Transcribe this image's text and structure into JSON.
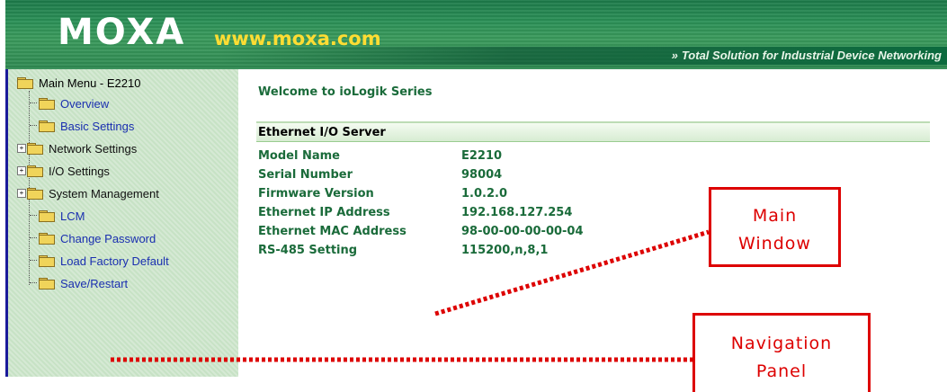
{
  "header": {
    "logo_text": "MOXA",
    "url": "www.moxa.com",
    "tagline_chevron": "»",
    "tagline": "Total Solution for Industrial Device Networking",
    "brand_color": "#2a8f56",
    "url_color": "#ffdd33"
  },
  "nav": {
    "root_label": "Main Menu - E2210",
    "items": [
      {
        "label": "Overview",
        "expandable": false
      },
      {
        "label": "Basic Settings",
        "expandable": false
      },
      {
        "label": "Network Settings",
        "expandable": true
      },
      {
        "label": "I/O Settings",
        "expandable": true
      },
      {
        "label": "System Management",
        "expandable": true
      },
      {
        "label": "LCM",
        "expandable": false
      },
      {
        "label": "Change Password",
        "expandable": false
      },
      {
        "label": "Load Factory Default",
        "expandable": false
      },
      {
        "label": "Save/Restart",
        "expandable": false
      }
    ],
    "expander_symbol": "+"
  },
  "main": {
    "welcome": "Welcome to ioLogik Series",
    "section_title": "Ethernet I/O Server",
    "rows": [
      {
        "label": "Model Name",
        "value": "E2210"
      },
      {
        "label": "Serial Number",
        "value": "98004"
      },
      {
        "label": "Firmware Version",
        "value": "1.0.2.0"
      },
      {
        "label": "Ethernet IP Address",
        "value": "192.168.127.254"
      },
      {
        "label": "Ethernet MAC Address",
        "value": "98-00-00-00-00-04"
      },
      {
        "label": "RS-485 Setting",
        "value": "115200,n,8,1"
      }
    ]
  },
  "annotations": {
    "main_window": {
      "line1": "Main",
      "line2": "Window"
    },
    "navigation_panel": {
      "line1": "Navigation",
      "line2": "Panel"
    },
    "color": "#dd0000"
  }
}
